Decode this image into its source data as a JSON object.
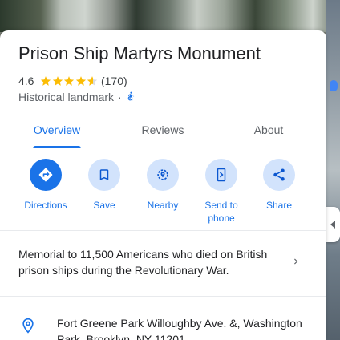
{
  "place": {
    "name": "Prison Ship Martyrs Monument",
    "rating": "4.6",
    "rating_value": 4.6,
    "review_count": "(170)",
    "category": "Historical landmark",
    "separator": "·"
  },
  "tabs": [
    {
      "label": "Overview",
      "active": true
    },
    {
      "label": "Reviews",
      "active": false
    },
    {
      "label": "About",
      "active": false
    }
  ],
  "actions": [
    {
      "label": "Directions",
      "icon": "directions-icon"
    },
    {
      "label": "Save",
      "icon": "bookmark-icon"
    },
    {
      "label": "Nearby",
      "icon": "nearby-icon"
    },
    {
      "label": "Send to phone",
      "icon": "send-to-phone-icon"
    },
    {
      "label": "Share",
      "icon": "share-icon"
    }
  ],
  "description": "Memorial to 11,500 Americans who died on British prison ships during the Revolutionary War.",
  "address": "Fort Greene Park Willoughby Ave. &, Washington Park, Brooklyn, NY 11201",
  "colors": {
    "accent": "#1a73e8",
    "action_bg": "#d2e3fc",
    "star": "#fbbc04"
  }
}
